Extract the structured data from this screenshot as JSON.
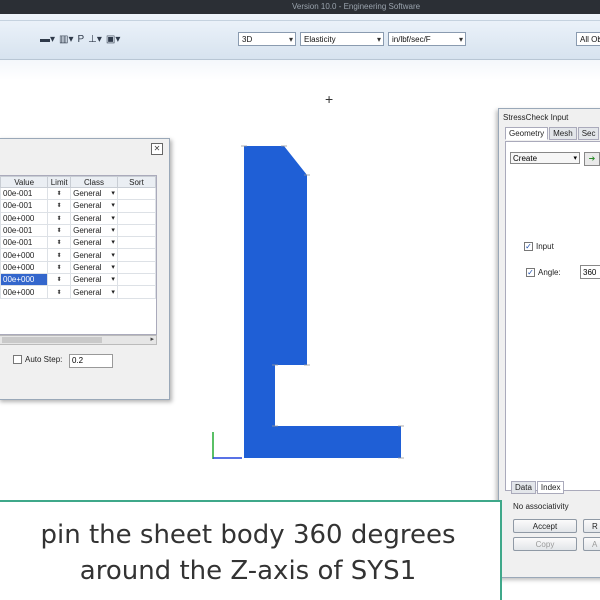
{
  "window": {
    "title": "Version 10.0 - Engineering Software"
  },
  "toolbar": {
    "view_mode": "3D",
    "analysis_type": "Elasticity",
    "units": "in/lbf/sec/F",
    "filter": "All Ob"
  },
  "left_dialog": {
    "columns": [
      "Value",
      "Limit",
      "Class",
      "Sort"
    ],
    "rows": [
      {
        "value": "00e-001",
        "class": "General"
      },
      {
        "value": "00e-001",
        "class": "General"
      },
      {
        "value": "00e+000",
        "class": "General"
      },
      {
        "value": "00e-001",
        "class": "General"
      },
      {
        "value": "00e-001",
        "class": "General"
      },
      {
        "value": "00e+000",
        "class": "General"
      },
      {
        "value": "00e+000",
        "class": "General"
      },
      {
        "value": "00e+000",
        "class": "General"
      },
      {
        "value": "00e+000",
        "class": "General"
      }
    ],
    "selected_row": 7,
    "auto_step_label": "Auto Step:",
    "auto_step_value": "0.2"
  },
  "right_dialog": {
    "title": "StressCheck Input",
    "tabs": [
      "Geometry",
      "Mesh",
      "Sec"
    ],
    "active_tab": "Geometry",
    "action": "Create",
    "input_label": "Input",
    "input_checked": true,
    "angle_label": "Angle:",
    "angle_checked": true,
    "angle_value": "360",
    "bottom_tabs": [
      "Data",
      "Index"
    ],
    "associativity": "No associativity",
    "buttons": {
      "accept": "Accept",
      "copy": "Copy",
      "r": "R",
      "a": "A"
    }
  },
  "colors": {
    "shape_fill": "#1f5fd6",
    "caption_border": "#3fa88a"
  },
  "caption": {
    "line1": "pin the sheet body 360 degrees",
    "line2": "around the Z-axis of SYS1"
  }
}
